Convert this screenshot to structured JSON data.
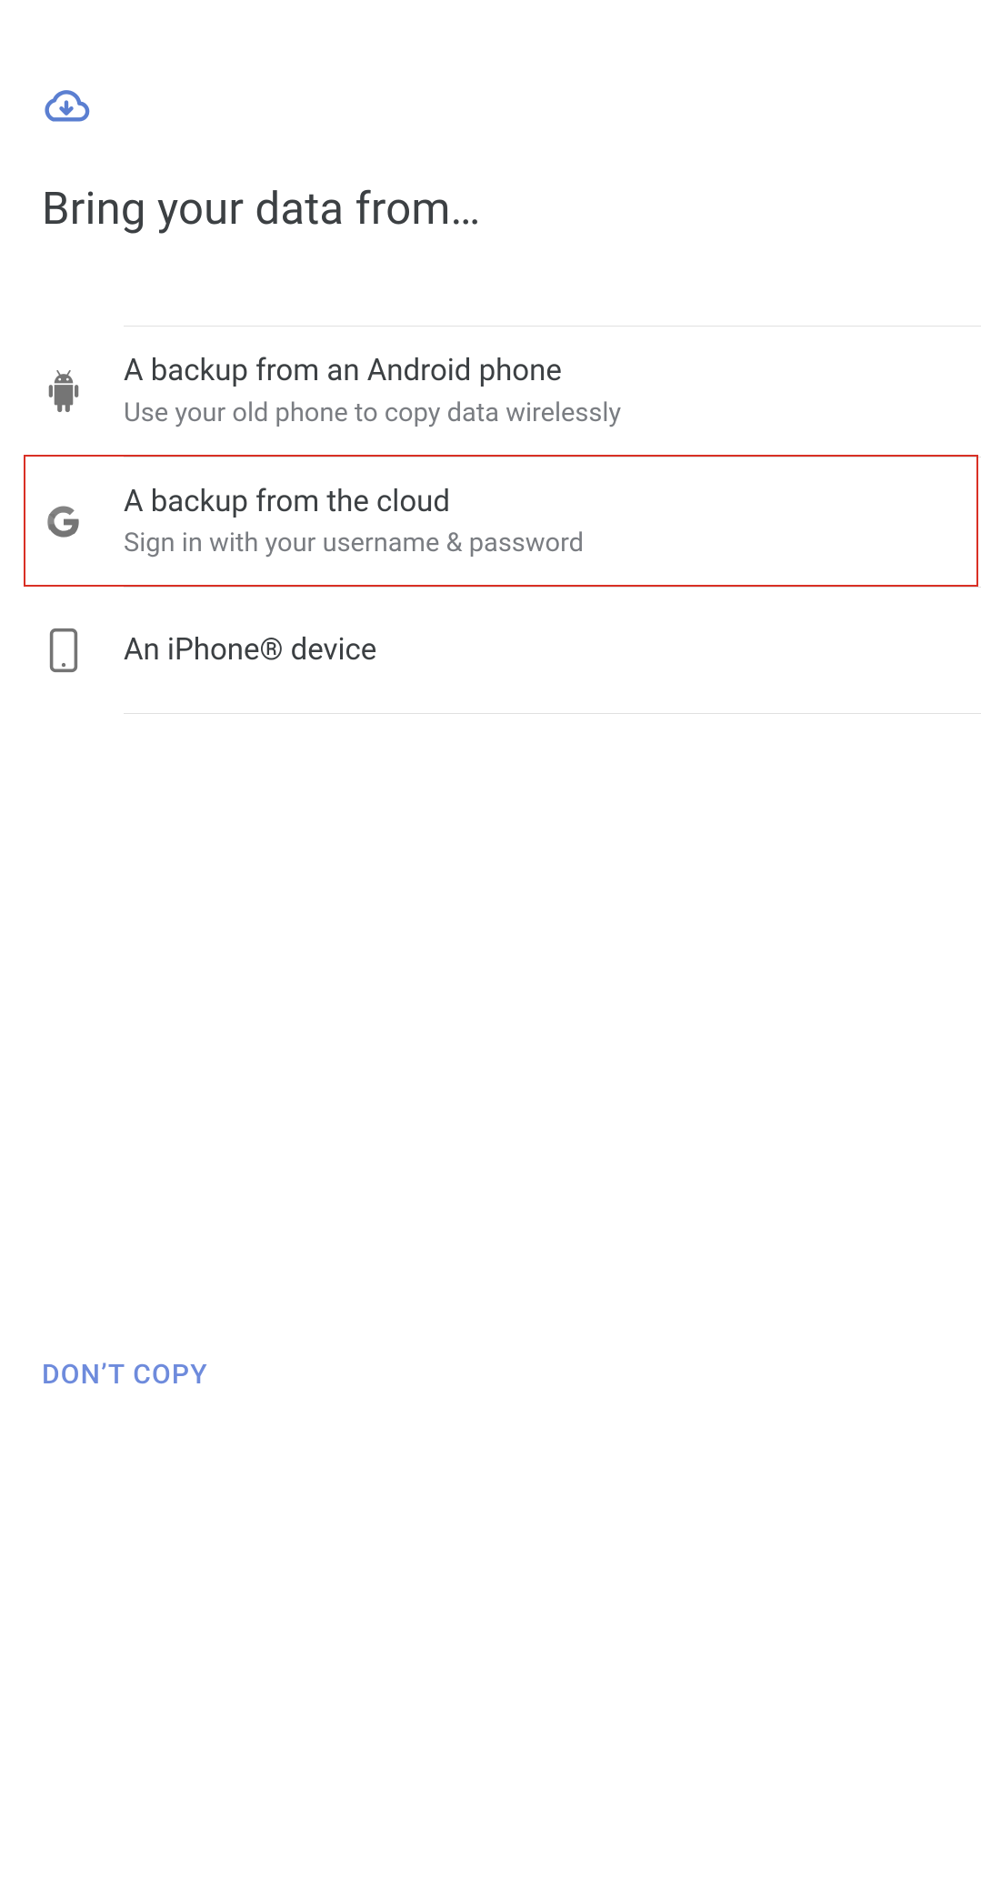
{
  "header": {
    "title": "Bring your data from…"
  },
  "options": [
    {
      "icon": "android",
      "title": "A backup from an Android phone",
      "sub": "Use your old phone to copy data wirelessly"
    },
    {
      "icon": "google",
      "title": "A backup from the cloud",
      "sub": "Sign in with your username & password"
    },
    {
      "icon": "iphone",
      "title": "An iPhone® device",
      "sub": ""
    }
  ],
  "footer": {
    "dont_copy": "DON’T COPY"
  },
  "highlighted_index": 1
}
